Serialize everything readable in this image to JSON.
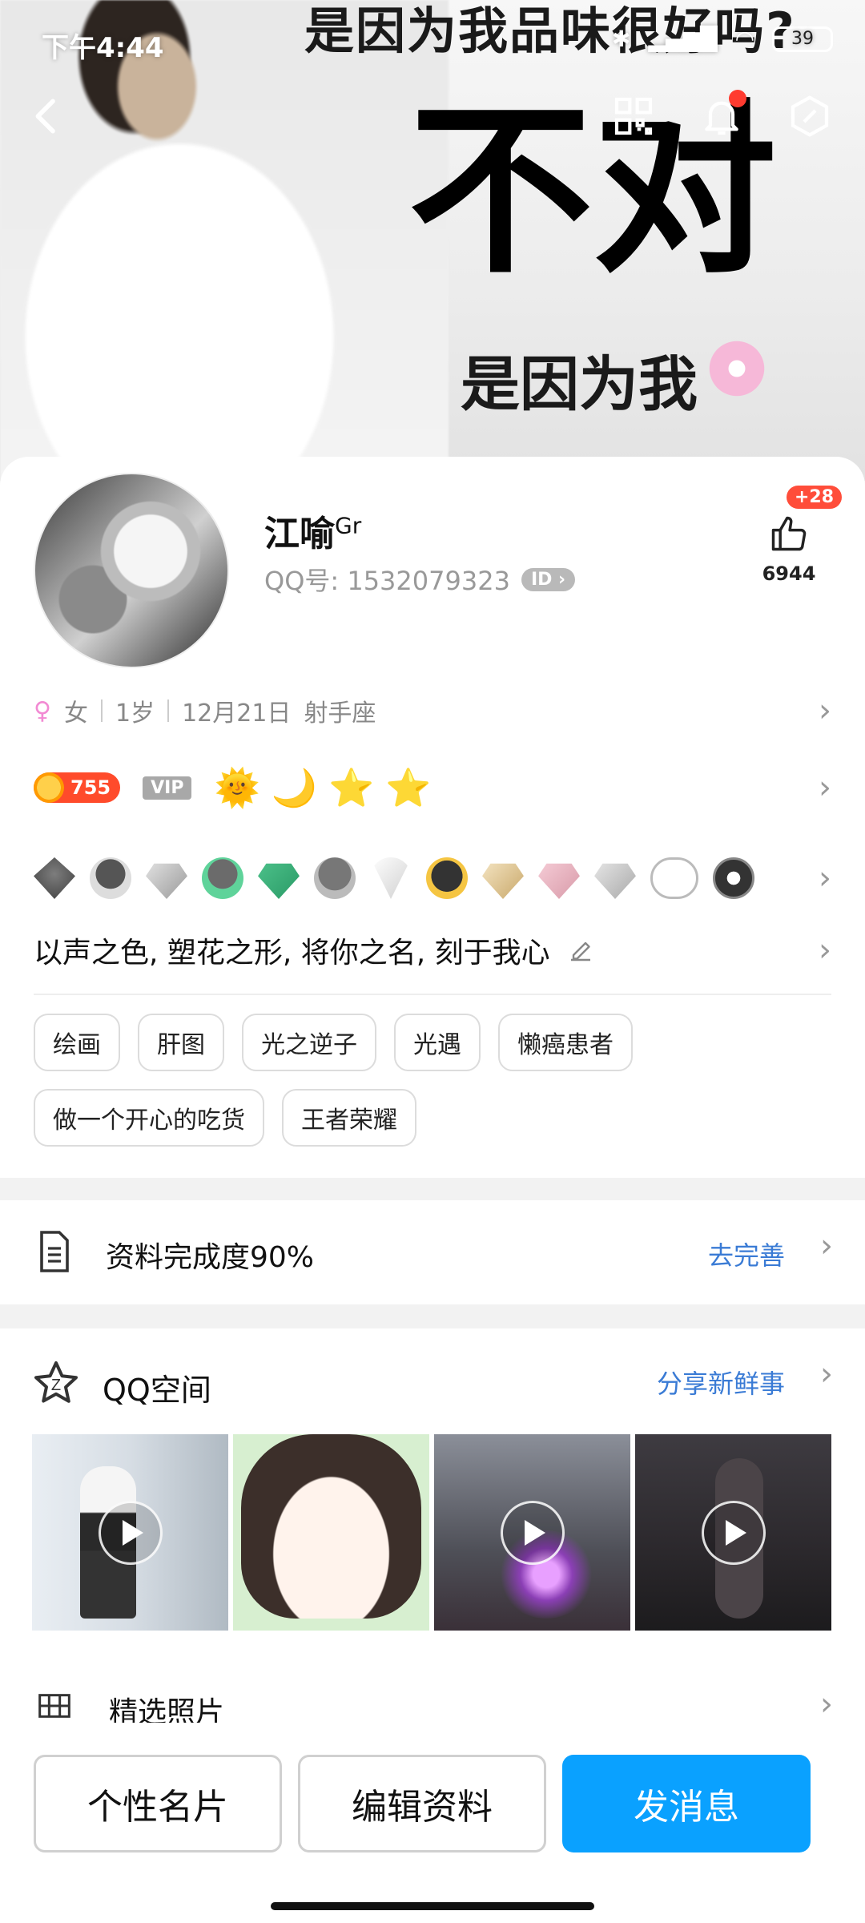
{
  "status_bar": {
    "time": "下午4:44",
    "battery": "39"
  },
  "cover": {
    "top_text": "是因为我品味很好吗?",
    "big_text": "不对",
    "sub_text": "是因为我"
  },
  "profile": {
    "nickname": "江喻",
    "nickname_sup": "Gr",
    "qq_label": "QQ号: 1532079323",
    "id_badge": "ID",
    "likes_plus": "+28",
    "likes_count": "6944"
  },
  "info": {
    "gender": "女",
    "age": "1岁",
    "birthday": "12月21日",
    "zodiac": "射手座"
  },
  "levels": {
    "score": "755",
    "vip": "VIP"
  },
  "signature": "以声之色, 塑花之形, 将你之名, 刻于我心",
  "tags": [
    "绘画",
    "肝图",
    "光之逆子",
    "光遇",
    "懒癌患者",
    "做一个开心的吃货",
    "王者荣耀"
  ],
  "completeness": {
    "label": "资料完成度90%",
    "action": "去完善"
  },
  "qzone": {
    "title": "QQ空间",
    "action": "分享新鲜事",
    "photos_title": "精选照片"
  },
  "buttons": {
    "card": "个性名片",
    "edit": "编辑资料",
    "message": "发消息"
  },
  "colors": {
    "accent": "#0aa1ff",
    "link": "#3a7bd5",
    "badge_red": "#ff4b2b"
  }
}
